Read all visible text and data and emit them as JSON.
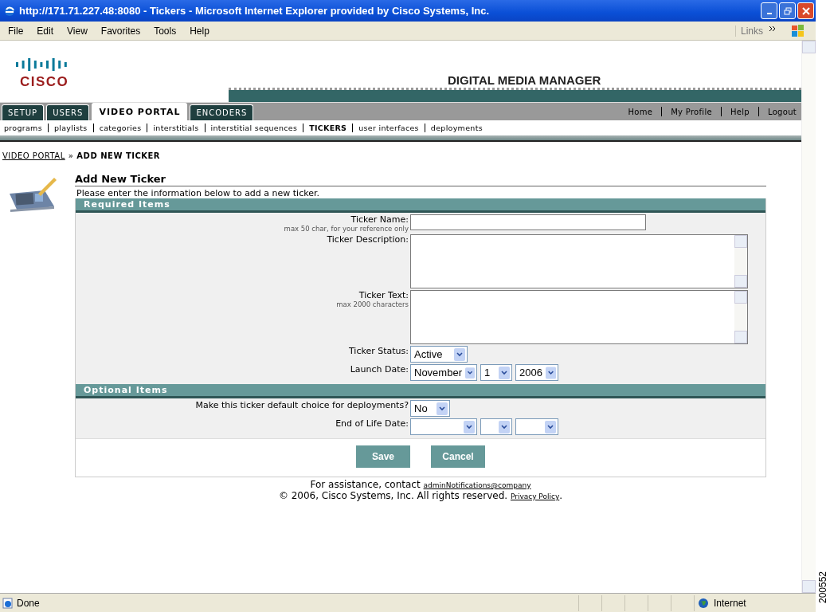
{
  "window": {
    "title": "http://171.71.227.48:8080 - Tickers - Microsoft Internet Explorer provided by Cisco Systems, Inc."
  },
  "menu": [
    {
      "label": "File"
    },
    {
      "label": "Edit"
    },
    {
      "label": "View"
    },
    {
      "label": "Favorites"
    },
    {
      "label": "Tools"
    },
    {
      "label": "Help"
    }
  ],
  "links_label": "Links",
  "header": {
    "logo_text": "CISCO",
    "brand": "DIGITAL MEDIA MANAGER"
  },
  "tabs": [
    {
      "label": "SETUP",
      "selected": false
    },
    {
      "label": "USERS",
      "selected": false
    },
    {
      "label": "VIDEO PORTAL",
      "selected": true
    },
    {
      "label": "ENCODERS",
      "selected": false
    }
  ],
  "utility_links": [
    "Home",
    "My Profile",
    "Help",
    "Logout"
  ],
  "subnav": [
    {
      "label": "programs",
      "selected": false
    },
    {
      "label": "playlists",
      "selected": false
    },
    {
      "label": "categories",
      "selected": false
    },
    {
      "label": "interstitials",
      "selected": false
    },
    {
      "label": "interstitial sequences",
      "selected": false
    },
    {
      "label": "TICKERS",
      "selected": true
    },
    {
      "label": "user interfaces",
      "selected": false
    },
    {
      "label": "deployments",
      "selected": false
    }
  ],
  "breadcrumb": {
    "link": "VIDEO PORTAL",
    "separator": "»",
    "current": "ADD NEW TICKER"
  },
  "form": {
    "title": "Add New Ticker",
    "intro": "Please enter the information below to add a new ticker.",
    "sections": [
      {
        "title": "Required Items",
        "fields": [
          {
            "kind": "text",
            "label": "Ticker Name:",
            "hint": "max 50 char, for your reference only"
          },
          {
            "kind": "textarea",
            "label": "Ticker Description:"
          },
          {
            "kind": "textarea",
            "label": "Ticker Text:",
            "hint": "max 2000 characters"
          },
          {
            "kind": "select",
            "label": "Ticker Status:",
            "value": "Active"
          },
          {
            "kind": "date",
            "label": "Launch Date:",
            "parts": [
              {
                "value": "November"
              },
              {
                "value": "1"
              },
              {
                "value": "2006"
              }
            ]
          }
        ]
      },
      {
        "title": "Optional Items",
        "fields": [
          {
            "kind": "select",
            "label": "Make this ticker default choice for deployments?",
            "value": "No"
          },
          {
            "kind": "blank_date",
            "label": "End of Life Date:"
          }
        ]
      }
    ],
    "buttons": [
      "Save",
      "Cancel"
    ]
  },
  "footer": {
    "assistance": "For assistance, contact",
    "email": "adminNotifications@company",
    "copyright": "© 2006, Cisco Systems, Inc. All rights reserved.",
    "privacy": "Privacy Policy",
    "end": "."
  },
  "status_bar": {
    "text": "Done",
    "zone": "Internet"
  },
  "figure_number": "200552"
}
